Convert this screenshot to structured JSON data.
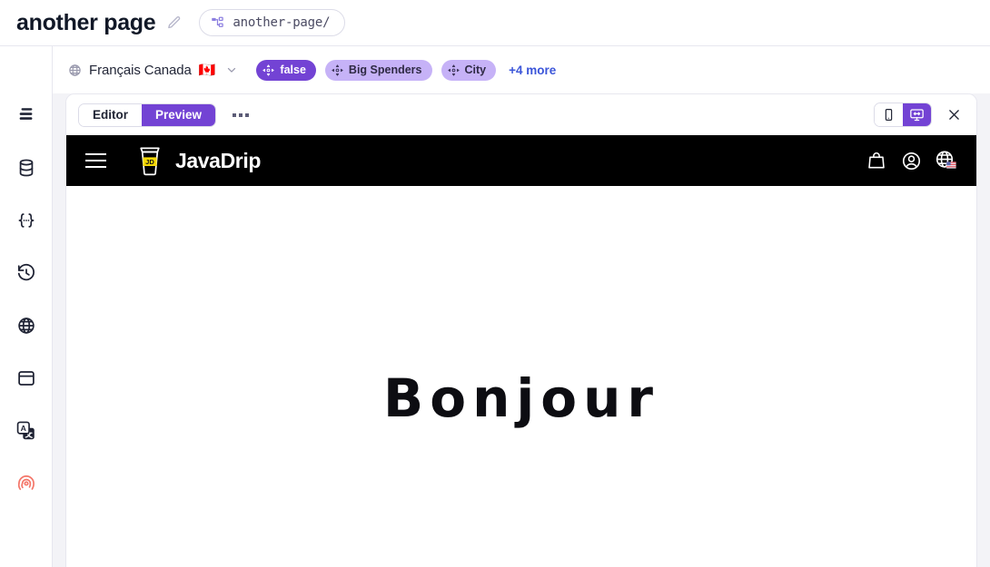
{
  "topbar": {
    "page_title": "another page",
    "edit_icon": "pencil-icon",
    "url_icon": "sitemap-icon",
    "url_text": "another-page/"
  },
  "sidebar": {
    "items": [
      {
        "name": "sidebar-item-pages",
        "icon": "layers-menu-icon"
      },
      {
        "name": "sidebar-item-data",
        "icon": "database-icon"
      },
      {
        "name": "sidebar-item-variables",
        "icon": "code-braces-icon"
      },
      {
        "name": "sidebar-item-history",
        "icon": "clock-rewind-icon"
      },
      {
        "name": "sidebar-item-locales",
        "icon": "globe-icon"
      },
      {
        "name": "sidebar-item-layouts",
        "icon": "window-icon"
      },
      {
        "name": "sidebar-item-translations",
        "icon": "translate-icon"
      },
      {
        "name": "sidebar-item-personalization",
        "icon": "fingerprint-icon"
      }
    ],
    "accent_color": "#f4776a"
  },
  "context_bar": {
    "globe_icon": "globe-icon",
    "locale_label": "Français Canada",
    "locale_flag": "🇨🇦",
    "chevron_icon": "chevron-down-icon",
    "pills": [
      {
        "label": "false",
        "icon": "target-move-icon",
        "style": "solid"
      },
      {
        "label": "Big Spenders",
        "icon": "target-move-icon",
        "style": "soft"
      },
      {
        "label": "City",
        "icon": "target-move-icon",
        "style": "soft"
      }
    ],
    "more_label": "+4 more",
    "more_color": "#3b55d9"
  },
  "preview": {
    "tabs": [
      {
        "label": "Editor",
        "active": false
      },
      {
        "label": "Preview",
        "active": true
      }
    ],
    "overflow_icon": "ellipsis-icon",
    "devices": [
      {
        "name": "mobile-view-button",
        "icon": "mobile-icon",
        "active": false
      },
      {
        "name": "desktop-view-button",
        "icon": "desktop-responsive-icon",
        "active": true
      }
    ],
    "close_icon": "close-icon",
    "accent_color": "#7343d4"
  },
  "site": {
    "menu_icon": "hamburger-icon",
    "logo_icon": "coffee-cup-icon",
    "logo_badge": "JD",
    "brand_name": "JavaDrip",
    "header_bg": "#000000",
    "icons": [
      {
        "name": "shopping-bag-icon"
      },
      {
        "name": "user-account-icon"
      },
      {
        "name": "globe-language-icon"
      }
    ],
    "hero_heading": "Bonjour"
  }
}
